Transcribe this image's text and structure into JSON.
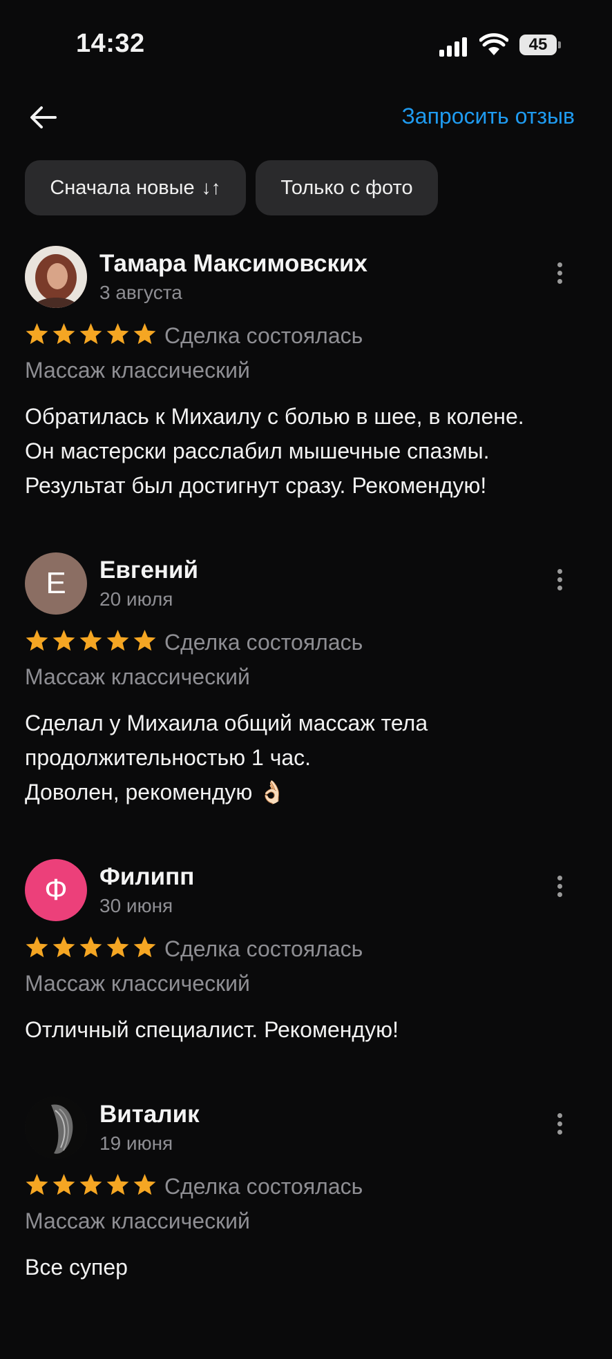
{
  "status": {
    "time": "14:32",
    "battery": "45"
  },
  "header": {
    "request_review": "Запросить отзыв"
  },
  "filters": {
    "sort": "Сначала новые",
    "sort_icon": "↓↑",
    "photo_only": "Только с фото"
  },
  "reviews": [
    {
      "author": "Тамара Максимовских",
      "date": "3 августа",
      "avatar": {
        "type": "photo",
        "letter": "",
        "color": "#7a4a3c"
      },
      "rating": 5,
      "deal": "Сделка состоялась",
      "service": "Массаж классический",
      "text_lines": [
        "Обратилась к Михаилу с болью в шее, в колене.",
        "Он мастерски расслабил мышечные спазмы.",
        "Результат был достигнут сразу. Рекомендую!"
      ]
    },
    {
      "author": "Евгений",
      "date": "20 июля",
      "avatar": {
        "type": "letter",
        "letter": "Е",
        "color": "#8b6e63"
      },
      "rating": 5,
      "deal": "Сделка состоялась",
      "service": "Массаж классический",
      "text_lines": [
        "Сделал у Михаила общий массаж тела",
        "продолжительностью 1 час.",
        "Доволен, рекомендую 👌🏻"
      ]
    },
    {
      "author": "Филипп",
      "date": "30 июня",
      "avatar": {
        "type": "letter",
        "letter": "Ф",
        "color": "#ec407a"
      },
      "rating": 5,
      "deal": "Сделка состоялась",
      "service": "Массаж классический",
      "text_lines": [
        "Отличный специалист. Рекомендую!"
      ]
    },
    {
      "author": "Виталик",
      "date": "19 июня",
      "avatar": {
        "type": "photo",
        "letter": "",
        "color": "#1b1b1b"
      },
      "rating": 5,
      "deal": "Сделка состоялась",
      "service": "Массаж классический",
      "text_lines": [
        "Все супер"
      ]
    }
  ],
  "colors": {
    "accent": "#1f9bf0",
    "star": "#f5a623",
    "secondary_text": "#8e8e93",
    "background": "#0a0a0b"
  }
}
